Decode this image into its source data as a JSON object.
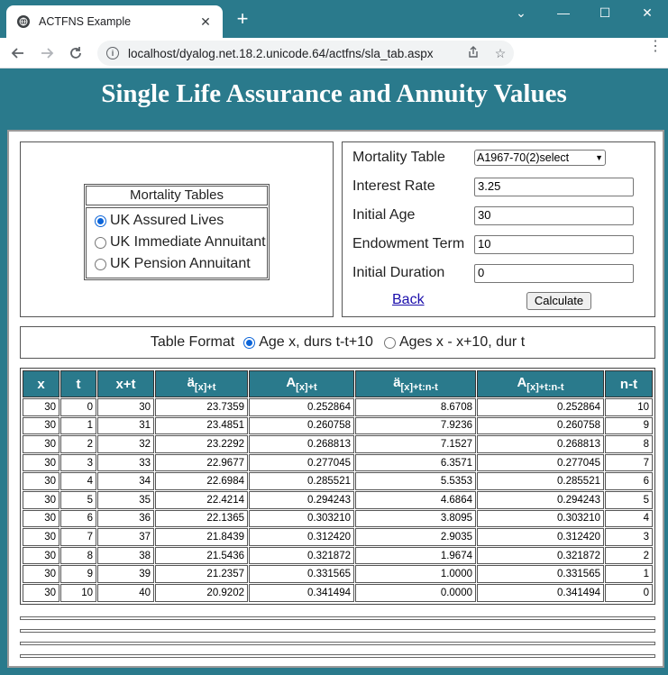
{
  "browser": {
    "tab_title": "ACTFNS Example",
    "tab_close": "✕",
    "new_tab": "+",
    "url": "localhost/dyalog.net.18.2.unicode.64/actfns/sla_tab.aspx",
    "window_controls": [
      "⌄",
      "—",
      "☐",
      "✕"
    ]
  },
  "page": {
    "title": "Single Life Assurance and Annuity Values"
  },
  "mortality_tables": {
    "caption": "Mortality Tables",
    "options": [
      {
        "label": "UK Assured Lives",
        "selected": true
      },
      {
        "label": "UK Immediate Annuitant",
        "selected": false
      },
      {
        "label": "UK Pension Annuitant",
        "selected": false
      }
    ]
  },
  "form": {
    "mortality_table": {
      "label": "Mortality Table",
      "value": "A1967-70(2)select"
    },
    "interest_rate": {
      "label": "Interest Rate",
      "value": "3.25"
    },
    "initial_age": {
      "label": "Initial Age",
      "value": "30"
    },
    "endowment_term": {
      "label": "Endowment Term",
      "value": "10"
    },
    "initial_duration": {
      "label": "Initial Duration",
      "value": "0"
    },
    "back_label": "Back",
    "calculate_label": "Calculate"
  },
  "table_format": {
    "label": "Table Format",
    "options": [
      {
        "label": "Age x, durs t-t+10",
        "selected": true
      },
      {
        "label": "Ages x - x+10, dur t",
        "selected": false
      }
    ]
  },
  "results": {
    "headers": [
      {
        "main": "x",
        "sub": ""
      },
      {
        "main": "t",
        "sub": ""
      },
      {
        "main": "x+t",
        "sub": ""
      },
      {
        "main": "ä",
        "sub": "[x]+t"
      },
      {
        "main": "A",
        "sub": "[x]+t"
      },
      {
        "main": "ä",
        "sub": "[x]+t:n-t"
      },
      {
        "main": "A",
        "sub": "[x]+t:n-t"
      },
      {
        "main": "n-t",
        "sub": ""
      }
    ],
    "rows": [
      [
        "30",
        "0",
        "30",
        "23.7359",
        "0.252864",
        "8.6708",
        "0.252864",
        "10"
      ],
      [
        "30",
        "1",
        "31",
        "23.4851",
        "0.260758",
        "7.9236",
        "0.260758",
        "9"
      ],
      [
        "30",
        "2",
        "32",
        "23.2292",
        "0.268813",
        "7.1527",
        "0.268813",
        "8"
      ],
      [
        "30",
        "3",
        "33",
        "22.9677",
        "0.277045",
        "6.3571",
        "0.277045",
        "7"
      ],
      [
        "30",
        "4",
        "34",
        "22.6984",
        "0.285521",
        "5.5353",
        "0.285521",
        "6"
      ],
      [
        "30",
        "5",
        "35",
        "22.4214",
        "0.294243",
        "4.6864",
        "0.294243",
        "5"
      ],
      [
        "30",
        "6",
        "36",
        "22.1365",
        "0.303210",
        "3.8095",
        "0.303210",
        "4"
      ],
      [
        "30",
        "7",
        "37",
        "21.8439",
        "0.312420",
        "2.9035",
        "0.312420",
        "3"
      ],
      [
        "30",
        "8",
        "38",
        "21.5436",
        "0.321872",
        "1.9674",
        "0.321872",
        "2"
      ],
      [
        "30",
        "9",
        "39",
        "21.2357",
        "0.331565",
        "1.0000",
        "0.331565",
        "1"
      ],
      [
        "30",
        "10",
        "40",
        "20.9202",
        "0.341494",
        "0.0000",
        "0.341494",
        "0"
      ]
    ]
  },
  "colors": {
    "header_teal": "#2a7a8c",
    "link_blue": "#1a0dab",
    "radio_blue": "#0b64d8"
  }
}
